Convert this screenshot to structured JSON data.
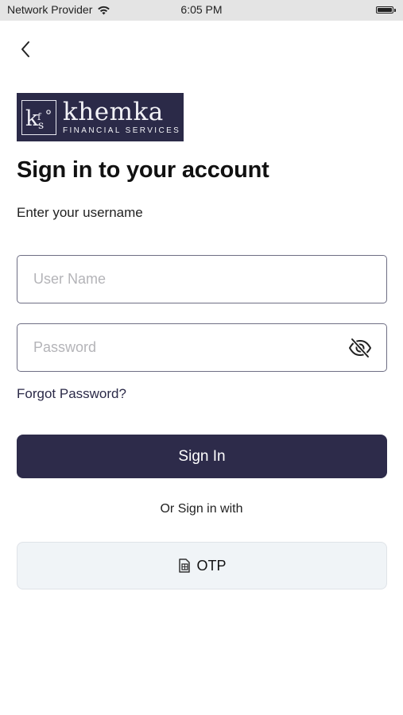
{
  "status_bar": {
    "carrier": "Network Provider",
    "time": "6:05 PM"
  },
  "brand": {
    "name": "khemka",
    "subtitle": "FINANCIAL SERVICES",
    "monogram": "KFS",
    "color": "#2b2a48"
  },
  "header": {
    "title": "Sign in to your account",
    "subtitle": "Enter your username"
  },
  "form": {
    "username_placeholder": "User Name",
    "username_value": "",
    "password_placeholder": "Password",
    "password_value": "",
    "forgot_password_label": "Forgot Password?",
    "sign_in_label": "Sign In"
  },
  "alt_login": {
    "divider_text": "Or Sign in with",
    "otp_label": "OTP"
  },
  "icons": {
    "back": "chevron-left-icon",
    "password_toggle": "eye-slash-icon",
    "otp": "sim-card-icon",
    "wifi": "wifi-icon",
    "battery": "battery-icon"
  },
  "colors": {
    "primary": "#2d2b4a",
    "otp_background": "#f0f4f7",
    "input_border": "#6e6e84",
    "placeholder": "#b4b4b8"
  }
}
